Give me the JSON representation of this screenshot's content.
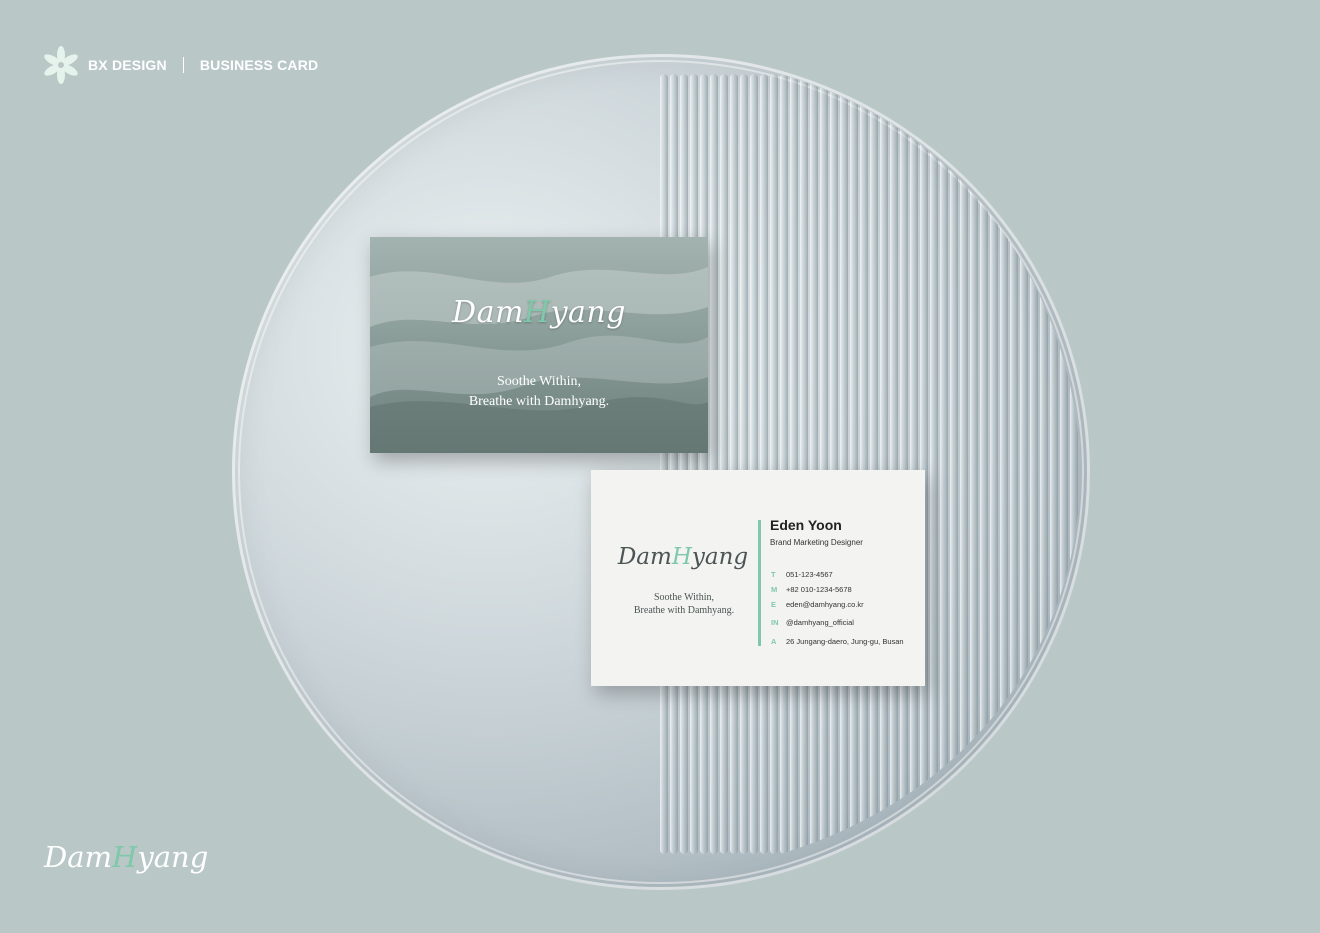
{
  "header": {
    "left_label": "BX DESIGN",
    "right_label": "BUSINESS CARD"
  },
  "colors": {
    "background": "#b9c8c7",
    "accent": "#7fc8a9",
    "white": "#ffffff"
  },
  "card_front": {
    "logo_part1": "Dam",
    "logo_accent": "H",
    "logo_part2": "yang",
    "tagline_line1": "Soothe Within,",
    "tagline_line2": "Breathe with Damhyang."
  },
  "card_back": {
    "logo_part1": "Dam",
    "logo_accent": "H",
    "logo_part2": "yang",
    "tagline_line1": "Soothe Within,",
    "tagline_line2": "Breathe with Damhyang.",
    "name": "Eden Yoon",
    "role": "Brand Marketing Designer",
    "contacts": [
      {
        "key": "T",
        "value": "051-123-4567"
      },
      {
        "key": "M",
        "value": "+82 010-1234-5678"
      },
      {
        "key": "E",
        "value": "eden@damhyang.co.kr"
      },
      {
        "key": "IN",
        "value": "@damhyang_official"
      },
      {
        "key": "A",
        "value": "26 Jungang-daero, Jung-gu, Busan"
      }
    ]
  },
  "footer_logo": {
    "part1": "Dam",
    "accent": "H",
    "part2": "yang"
  },
  "icons": {
    "header": "flower-icon"
  }
}
